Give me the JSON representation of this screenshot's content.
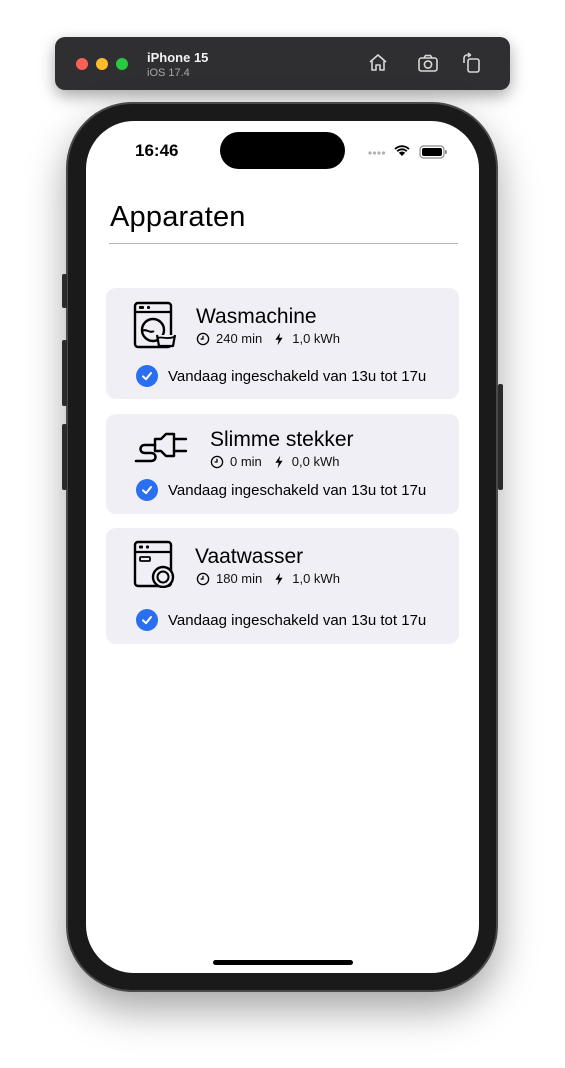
{
  "simulator": {
    "device_name": "iPhone 15",
    "os_version": "iOS 17.4",
    "buttons": [
      "home-icon",
      "screenshot-icon",
      "rotate-icon"
    ]
  },
  "status_bar": {
    "time": "16:46",
    "icons": [
      "signal-dots-icon",
      "wifi-icon",
      "battery-icon"
    ]
  },
  "page": {
    "title": "Apparaten"
  },
  "devices": [
    {
      "name": "Wasmachine",
      "icon": "washing-machine-icon",
      "duration": "240 min",
      "energy": "1,0 kWh",
      "status": "Vandaag ingeschakeld van 13u tot 17u"
    },
    {
      "name": "Slimme stekker",
      "icon": "smart-plug-icon",
      "duration": "0 min",
      "energy": "0,0 kWh",
      "status": "Vandaag ingeschakeld van 13u tot 17u"
    },
    {
      "name": "Vaatwasser",
      "icon": "dishwasher-icon",
      "duration": "180 min",
      "energy": "1,0 kWh",
      "status": "Vandaag ingeschakeld van 13u tot 17u"
    }
  ],
  "colors": {
    "card_background": "#efeff5",
    "check_accent": "#2a6ff0",
    "divider": "#b3b3b3"
  }
}
